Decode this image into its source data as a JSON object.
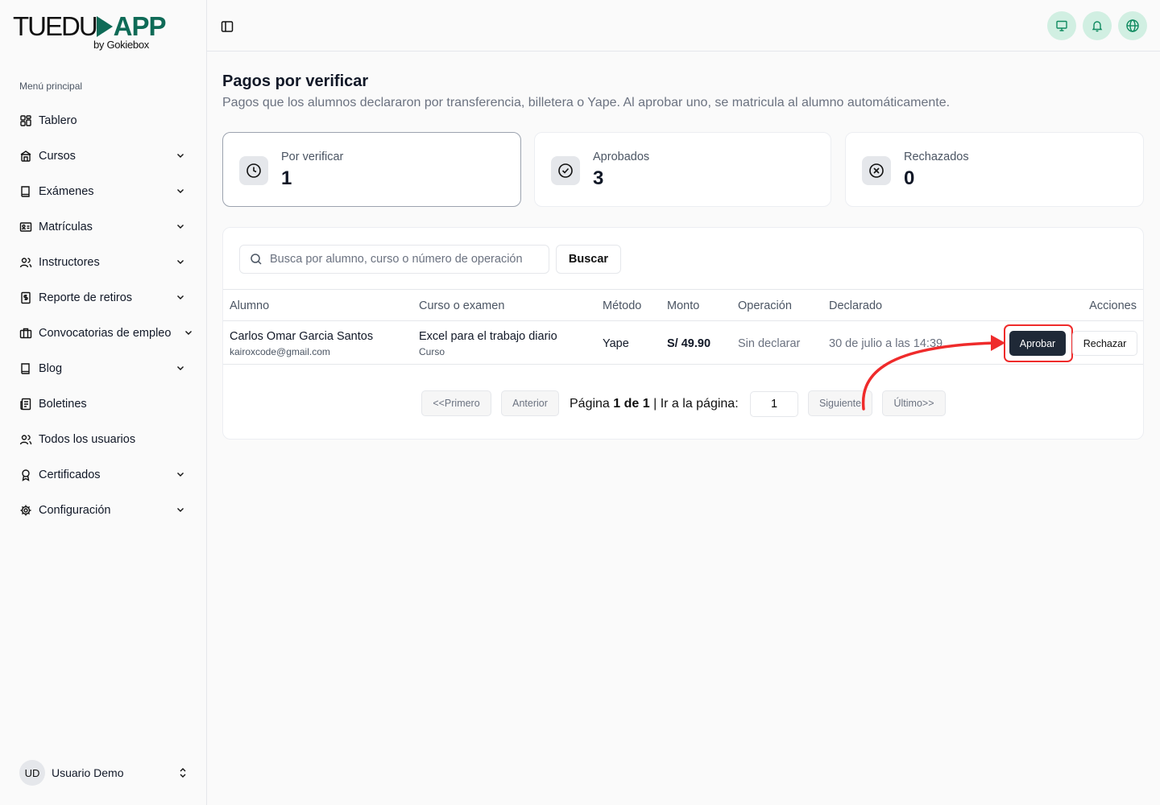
{
  "brand": {
    "name_left": "TUEDU",
    "name_right": "APP",
    "byline": "by Gokiebox",
    "accent": "#0f6b57"
  },
  "sidebar": {
    "section_label": "Menú principal",
    "items": [
      {
        "label": "Tablero",
        "icon": "dashboard-icon"
      },
      {
        "label": "Cursos",
        "icon": "courses-icon"
      },
      {
        "label": "Exámenes",
        "icon": "book-icon"
      },
      {
        "label": "Matrículas",
        "icon": "id-card-icon"
      },
      {
        "label": "Instructores",
        "icon": "users-icon"
      },
      {
        "label": "Reporte de retiros",
        "icon": "report-icon"
      },
      {
        "label": "Convocatorias de empleo",
        "icon": "briefcase-icon"
      },
      {
        "label": "Blog",
        "icon": "book-icon"
      },
      {
        "label": "Boletines",
        "icon": "newsletter-icon"
      },
      {
        "label": "Todos los usuarios",
        "icon": "users-icon"
      },
      {
        "label": "Certificados",
        "icon": "award-icon"
      },
      {
        "label": "Configuración",
        "icon": "gear-icon"
      }
    ],
    "user": {
      "initials": "UD",
      "name": "Usuario Demo"
    }
  },
  "page": {
    "title": "Pagos por verificar",
    "subtitle": "Pagos que los alumnos declararon por transferencia, billetera o Yape. Al aprobar uno, se matricula al alumno automáticamente."
  },
  "stats": [
    {
      "label": "Por verificar",
      "value": "1",
      "icon": "clock-icon"
    },
    {
      "label": "Aprobados",
      "value": "3",
      "icon": "check-circle-icon"
    },
    {
      "label": "Rechazados",
      "value": "0",
      "icon": "x-circle-icon"
    }
  ],
  "search": {
    "placeholder": "Busca por alumno, curso o número de operación",
    "button": "Buscar"
  },
  "table": {
    "headers": {
      "alumno": "Alumno",
      "curso": "Curso o examen",
      "metodo": "Método",
      "monto": "Monto",
      "operacion": "Operación",
      "declarado": "Declarado",
      "acciones": "Acciones"
    },
    "rows": [
      {
        "student_name": "Carlos Omar Garcia Santos",
        "student_email": "kairoxcode@gmail.com",
        "course": "Excel para el trabajo diario",
        "course_type": "Curso",
        "method": "Yape",
        "amount": "S/ 49.90",
        "operation": "Sin declarar",
        "declared": "30 de julio a las 14:39",
        "approve": "Aprobar",
        "reject": "Rechazar"
      }
    ]
  },
  "pagination": {
    "first": "<<Primero",
    "prev": "Anterior",
    "page_word": "Página",
    "page_of": "1 de 1",
    "goto": "| Ir a la página:",
    "page_input": "1",
    "next": "Siguiente",
    "last": "Último>>"
  },
  "colors": {
    "highlight": "#ef2b2b",
    "primary_button": "#1f2937",
    "icon_bg_top": "#d1efe2"
  }
}
